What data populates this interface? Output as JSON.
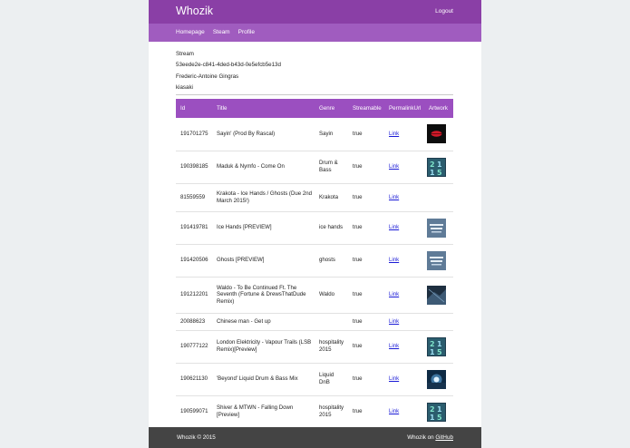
{
  "header": {
    "brand": "Whozik",
    "logout": "Logout"
  },
  "nav": {
    "items": [
      "Homepage",
      "Steam",
      "Profile"
    ]
  },
  "info": {
    "stream_label": "Stream",
    "stream_id": "53eede2e-c841-4ded-b43d-0e5efcb5e13d",
    "user_name": "Frederic-Antoine Gingras",
    "username": "kiasaki"
  },
  "table": {
    "headers": [
      "Id",
      "Title",
      "Genre",
      "Streamable",
      "PermalinkUrl",
      "Artwork"
    ],
    "rows": [
      {
        "id": "191701275",
        "title": "Sayin' (Prod By Rascal)",
        "genre": "Sayin",
        "streamable": "true",
        "link": "Link",
        "artwork": "red-lips-artwork"
      },
      {
        "id": "190398185",
        "title": "Maduk & Nymfo - Come On",
        "genre": "Drum & Bass",
        "streamable": "true",
        "link": "Link",
        "artwork": "2015-teal-artwork"
      },
      {
        "id": "81559559",
        "title": "Krakota - Ice Hands / Ghosts (Due 2nd March 2015!)",
        "genre": "Krakota",
        "streamable": "true",
        "link": "Link",
        "artwork": ""
      },
      {
        "id": "191419781",
        "title": "Ice Hands [PREVIEW]",
        "genre": "ice hands",
        "streamable": "true",
        "link": "Link",
        "artwork": "blue-text-artwork"
      },
      {
        "id": "191420506",
        "title": "Ghosts [PREVIEW]",
        "genre": "ghosts",
        "streamable": "true",
        "link": "Link",
        "artwork": "blue-text-artwork"
      },
      {
        "id": "191212201",
        "title": "Waldo - To Be Continued Ft. The Seventh (Fortune & DrewsThatDude Remix)",
        "genre": "Waldo",
        "streamable": "true",
        "link": "Link",
        "artwork": "dark-blue-artwork"
      },
      {
        "id": "20088623",
        "title": "Chinese man - Get up",
        "genre": "",
        "streamable": "true",
        "link": "Link",
        "artwork": ""
      },
      {
        "id": "190777122",
        "title": "London Elektricity - Vapour Trails (LSB Remix)[Preview]",
        "genre": "hospitality 2015",
        "streamable": "true",
        "link": "Link",
        "artwork": "2015-teal-artwork"
      },
      {
        "id": "190621130",
        "title": "'Beyond' Liquid Drum & Bass Mix",
        "genre": "Liquid DnB",
        "streamable": "true",
        "link": "Link",
        "artwork": "light-burst-artwork"
      },
      {
        "id": "190599071",
        "title": "Shiver & MTWN - Falling Down [Preview]",
        "genre": "hospitality 2015",
        "streamable": "true",
        "link": "Link",
        "artwork": "2015-teal-artwork"
      }
    ]
  },
  "footer": {
    "copyright": "Whozik © 2015",
    "on_text": "Whozik on ",
    "github": "GitHub"
  }
}
